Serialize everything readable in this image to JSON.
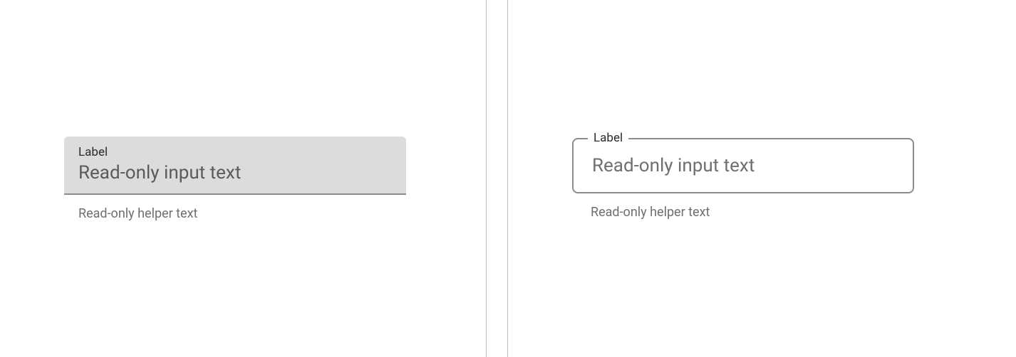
{
  "filled": {
    "label": "Label",
    "value": "Read-only input text",
    "helper": "Read-only helper text"
  },
  "outlined": {
    "label": "Label",
    "value": "Read-only input text",
    "helper": "Read-only helper text"
  }
}
